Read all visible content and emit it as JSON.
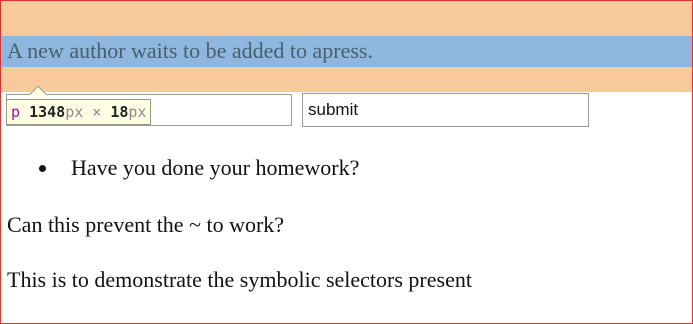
{
  "highlighted_paragraph": {
    "text": "A new author waits to be added to apress."
  },
  "inspector_tooltip": {
    "tag": "p",
    "width": "1348",
    "width_unit": "px",
    "separator": "×",
    "height": "18",
    "height_unit": "px"
  },
  "form": {
    "author_input": {
      "value": ""
    },
    "submit_field": {
      "value": "submit"
    }
  },
  "list": {
    "items": [
      "Have you done your homework?"
    ]
  },
  "paragraphs": [
    "Can this prevent the ~ to work?",
    "This is to demonstrate the symbolic selectors present"
  ],
  "colors": {
    "page_border": "#e0322f",
    "margin_highlight": "#f8c99a",
    "content_highlight": "#8eb6df",
    "tooltip_background": "#ffffe6",
    "tooltip_tag": "#a80c9c"
  }
}
